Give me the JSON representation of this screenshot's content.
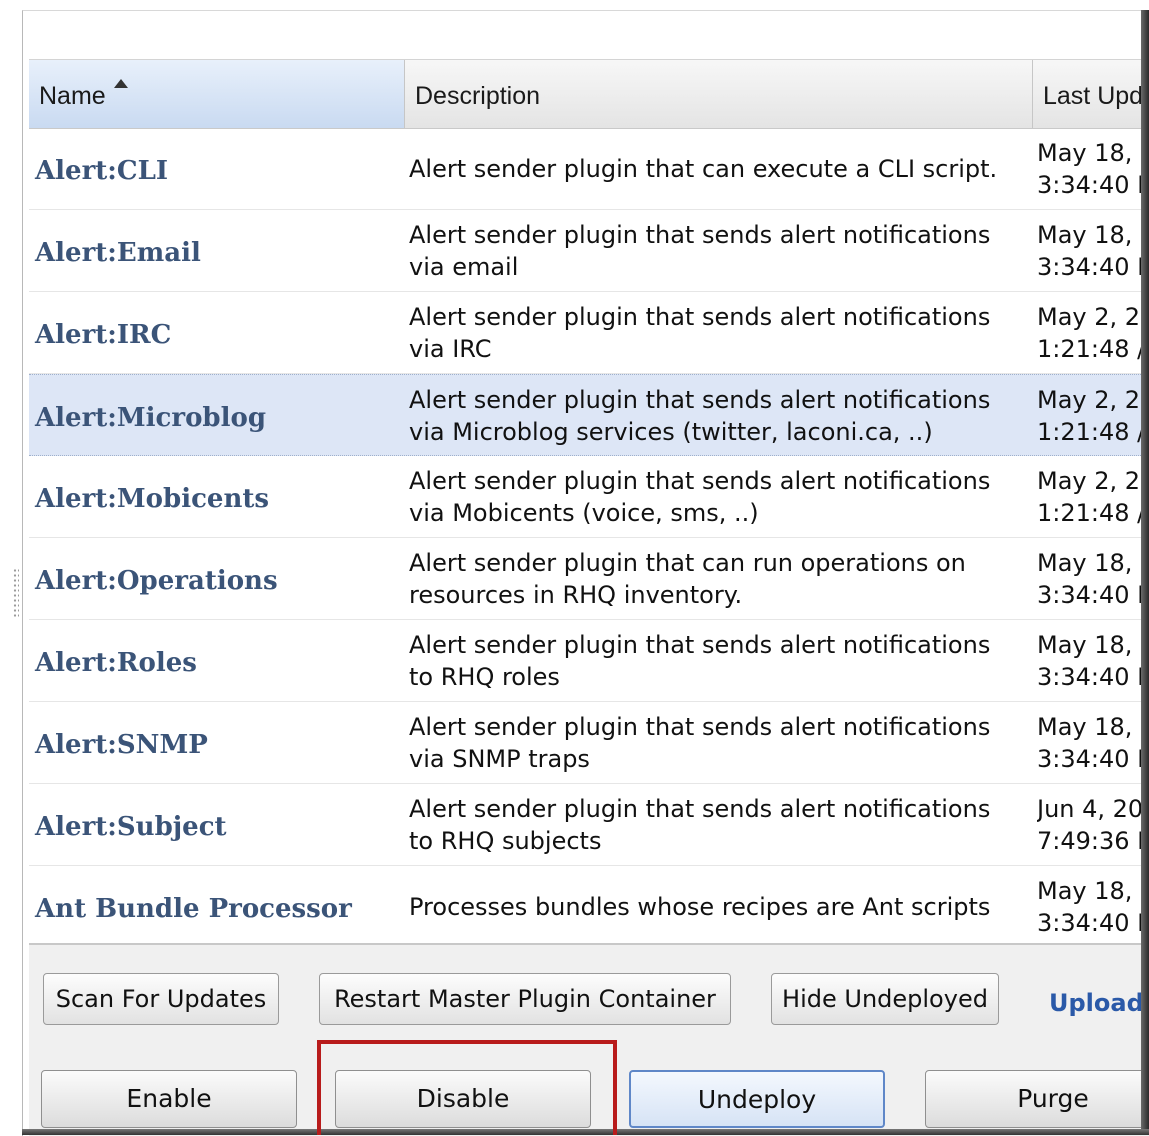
{
  "table": {
    "columns": {
      "name": "Name",
      "description": "Description",
      "last_updated": "Last Upd"
    },
    "sort_icon": "sort-ascending-icon",
    "rows": [
      {
        "name": "Alert:CLI",
        "description": "Alert sender plugin that can execute a CLI script.",
        "updated": "May 18,\n3:34:40 I",
        "selected": false
      },
      {
        "name": "Alert:Email",
        "description": "Alert sender plugin that sends alert notifications\nvia email",
        "updated": "May 18,\n3:34:40 I",
        "selected": false
      },
      {
        "name": "Alert:IRC",
        "description": "Alert sender plugin that sends alert notifications\nvia IRC",
        "updated": "May 2, 2\n1:21:48 /",
        "selected": false
      },
      {
        "name": "Alert:Microblog",
        "description": "Alert sender plugin that sends alert notifications\nvia Microblog services (twitter, laconi.ca, ..)",
        "updated": "May 2, 2\n1:21:48 /",
        "selected": true
      },
      {
        "name": "Alert:Mobicents",
        "description": "Alert sender plugin that sends alert notifications\nvia Mobicents (voice, sms, ..)",
        "updated": "May 2, 2\n1:21:48 /",
        "selected": false
      },
      {
        "name": "Alert:Operations",
        "description": "Alert sender plugin that can run operations on\nresources in RHQ inventory.",
        "updated": "May 18,\n3:34:40 I",
        "selected": false
      },
      {
        "name": "Alert:Roles",
        "description": "Alert sender plugin that sends alert notifications\nto RHQ roles",
        "updated": "May 18,\n3:34:40 I",
        "selected": false
      },
      {
        "name": "Alert:SNMP",
        "description": "Alert sender plugin that sends alert notifications\nvia SNMP traps",
        "updated": "May 18,\n3:34:40 I",
        "selected": false
      },
      {
        "name": "Alert:Subject",
        "description": "Alert sender plugin that sends alert notifications\nto RHQ subjects",
        "updated": "Jun 4, 20\n7:49:36 I",
        "selected": false
      },
      {
        "name": "Ant Bundle Processor",
        "description": "Processes bundles whose recipes are Ant scripts",
        "updated": "May 18,\n3:34:40 I",
        "selected": false
      }
    ]
  },
  "toolbar": {
    "scan": "Scan For Updates",
    "restart": "Restart Master Plugin Container",
    "hide": "Hide Undeployed",
    "upload": "Upload"
  },
  "actions": {
    "enable": "Enable",
    "disable": "Disable",
    "undeploy": "Undeploy",
    "purge": "Purge"
  },
  "colors": {
    "name_link": "#3b5478",
    "selected_row": "#dde6f6",
    "highlight_box": "#b81b1b",
    "upload_link": "#2a59a8"
  }
}
